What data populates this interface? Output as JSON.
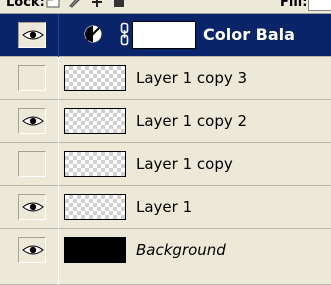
{
  "toolbar": {
    "lock_label": "Lock:",
    "fill_label": "Fill:"
  },
  "colors": {
    "panel_bg": "#ece9d8",
    "selected_bg": "#0a246a",
    "selected_text": "#ffffff"
  },
  "layers": [
    {
      "name": "Color Bala",
      "type": "adjustment",
      "visible": true,
      "selected": true,
      "icon": "adjustment-icon"
    },
    {
      "name": "Layer 1 copy 3",
      "type": "pixel",
      "visible": false,
      "selected": false
    },
    {
      "name": "Layer 1 copy 2",
      "type": "pixel",
      "visible": true,
      "selected": false
    },
    {
      "name": "Layer 1 copy",
      "type": "pixel",
      "visible": false,
      "selected": false
    },
    {
      "name": "Layer 1",
      "type": "pixel",
      "visible": true,
      "selected": false
    },
    {
      "name": "Background",
      "type": "background",
      "visible": true,
      "selected": false
    }
  ]
}
